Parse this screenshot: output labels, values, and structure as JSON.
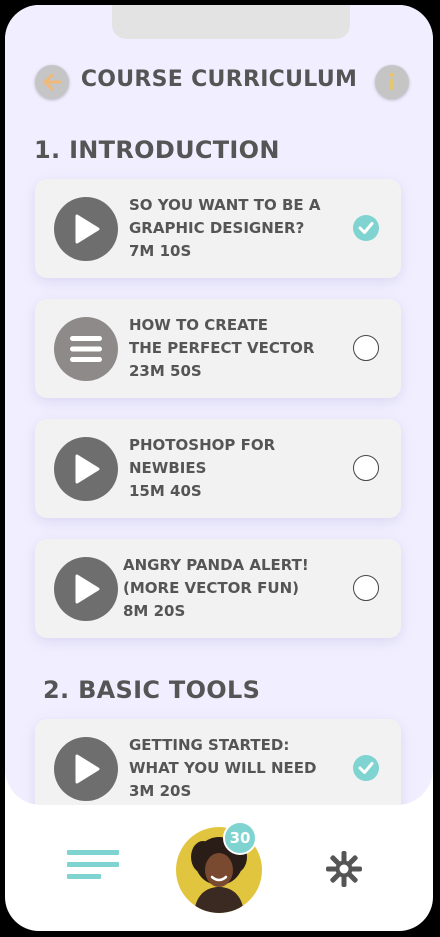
{
  "header": {
    "title": "COURSE CURRICULUM"
  },
  "sections": [
    {
      "title": "1. INTRODUCTION",
      "lessons": [
        {
          "line1": "SO YOU WANT TO BE A",
          "line2": "GRAPHIC DESIGNER?",
          "duration": "7M 10S",
          "completed": true,
          "thumb_icon": "play-icon"
        },
        {
          "line1": "HOW TO CREATE",
          "line2": "THE PERFECT VECTOR",
          "duration": "23M 50S",
          "completed": false,
          "thumb_icon": "menu-icon"
        },
        {
          "line1": "PHOTOSHOP FOR",
          "line2": "NEWBIES",
          "duration": "15M 40S",
          "completed": false,
          "thumb_icon": "play-icon"
        },
        {
          "line1": "ANGRY PANDA ALERT!",
          "line2": "(MORE VECTOR FUN)",
          "duration": "8M 20S",
          "completed": false,
          "thumb_icon": "play-icon"
        }
      ]
    },
    {
      "title": "2. BASIC TOOLS",
      "lessons": [
        {
          "line1": "GETTING STARTED:",
          "line2": "WHAT YOU WILL NEED",
          "duration": "3M 20S",
          "completed": true,
          "thumb_icon": "play-icon"
        }
      ]
    }
  ],
  "bottom_nav": {
    "menu_icon": "menu-lines-icon",
    "avatar_badge": "30",
    "settings_icon": "gear-icon"
  },
  "colors": {
    "accent": "#7fd3d0",
    "background": "#f1efff",
    "card": "#f2f2f2",
    "text": "#555555",
    "thumb": "#6e6e6e",
    "back_arrow": "#f0b97a",
    "info_letter": "#e8c66a",
    "avatar_bg": "#e2c53f"
  }
}
